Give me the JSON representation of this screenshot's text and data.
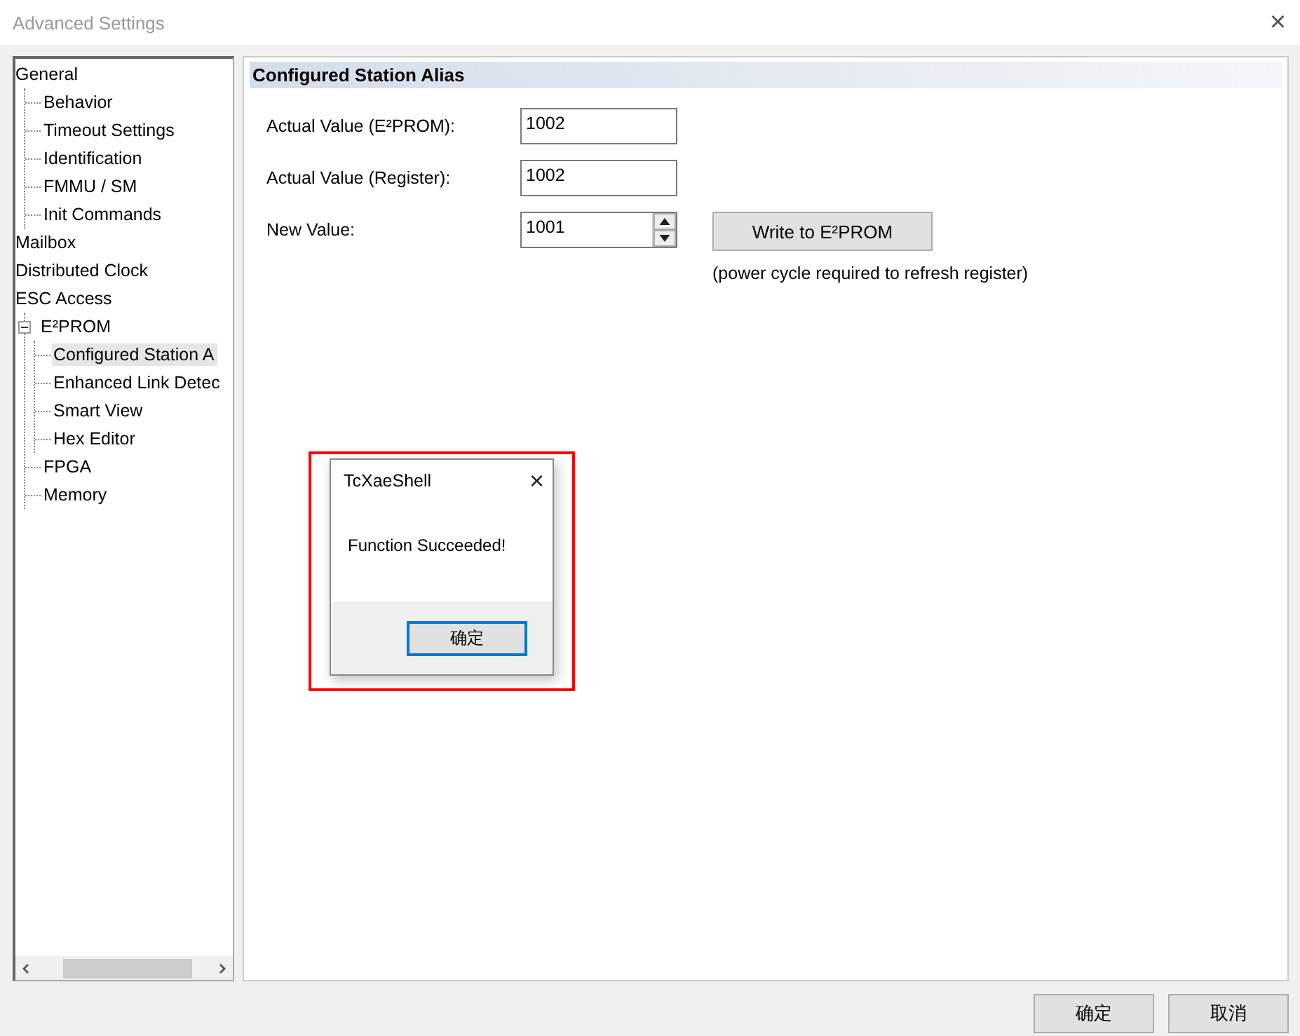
{
  "window": {
    "title": "Advanced Settings",
    "close": "×"
  },
  "tree": [
    {
      "label": "General",
      "selected": false,
      "expanded": true,
      "children": [
        {
          "label": "Behavior",
          "selected": false
        },
        {
          "label": "Timeout Settings",
          "selected": false
        },
        {
          "label": "Identification",
          "selected": false
        },
        {
          "label": "FMMU / SM",
          "selected": false
        },
        {
          "label": "Init Commands",
          "selected": false
        }
      ]
    },
    {
      "label": "Mailbox",
      "selected": false
    },
    {
      "label": "Distributed Clock",
      "selected": false
    },
    {
      "label": "ESC Access",
      "selected": false,
      "expanded": true,
      "children": [
        {
          "label": "E²PROM",
          "selected": false,
          "expanded": true,
          "children": [
            {
              "label": "Configured Station A",
              "selected": true
            },
            {
              "label": "Enhanced Link Detec",
              "selected": false
            },
            {
              "label": "Smart View",
              "selected": false
            },
            {
              "label": "Hex Editor",
              "selected": false
            }
          ]
        },
        {
          "label": "FPGA",
          "selected": false
        },
        {
          "label": "Memory",
          "selected": false
        }
      ]
    }
  ],
  "panel": {
    "title": "Configured Station Alias",
    "fields": [
      {
        "label": "Actual Value (E²PROM):",
        "value": "1002",
        "kind": "text"
      },
      {
        "label": "Actual Value (Register):",
        "value": "1002",
        "kind": "text"
      },
      {
        "label": "New Value:",
        "value": "1001",
        "kind": "spin"
      }
    ],
    "write_button": "Write to E²PROM",
    "note": "(power cycle required to refresh register)"
  },
  "dialog": {
    "title": "TcXaeShell",
    "close": "×",
    "message": "Function Succeeded!",
    "button": "确定",
    "highlighted": true
  },
  "buttons": [
    "确定",
    "取消"
  ]
}
